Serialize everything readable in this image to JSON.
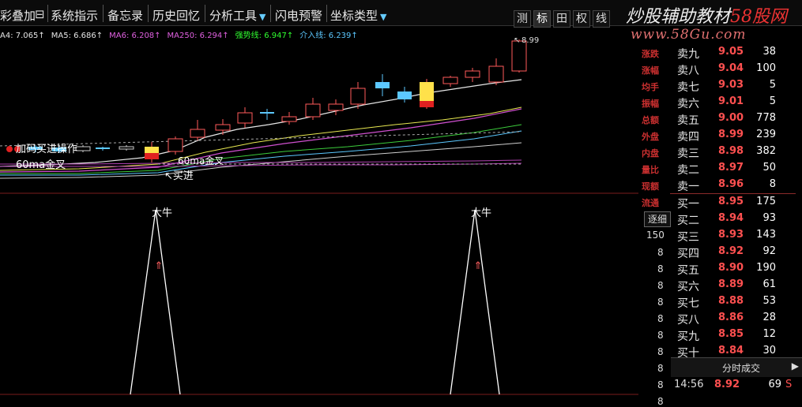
{
  "toolbar": {
    "items": [
      "彩叠加",
      "系统指示",
      "备忘录",
      "历史回忆",
      "分析工具",
      "闪电预警",
      "坐标类型"
    ],
    "right_buttons": [
      "测",
      "标",
      "田",
      "权",
      "线"
    ],
    "active_button": "标"
  },
  "watermark": {
    "text_prefix": "炒股辅助教材",
    "text_red": "58股网",
    "url": "www.58Gu.com"
  },
  "ma_indicators": [
    {
      "label": "A4: 7.065↑",
      "color": "#e6e6e6"
    },
    {
      "label": "MA5: 6.686↑",
      "color": "#e6e6e6"
    },
    {
      "label": "MA6: 6.208↑",
      "color": "#e060e0"
    },
    {
      "label": "MA250: 6.294↑",
      "color": "#e060e0"
    },
    {
      "label": "强势线: 6.947↑",
      "color": "#30ff30"
    },
    {
      "label": "介入线: 6.239↑",
      "color": "#5cc8ff"
    }
  ],
  "main_chart": {
    "high_label": "8.99",
    "annotations": {
      "add_position": "加码买进操作",
      "golden_cross": "60ma金叉",
      "follow_up": "60ma金叉",
      "buy": "买进"
    }
  },
  "indicator_chart": {
    "peak_label": "大牛",
    "peaks": [
      {
        "index": 0
      },
      {
        "index": 1
      }
    ]
  },
  "order_book": {
    "side_labels": [
      "涨跌",
      "涨幅",
      "均手",
      "振幅",
      "总额",
      "外盘",
      "内盘",
      "量比",
      "现额",
      "流通"
    ],
    "sells": [
      {
        "label": "卖九",
        "price": "9.05",
        "vol": "38"
      },
      {
        "label": "卖八",
        "price": "9.04",
        "vol": "100"
      },
      {
        "label": "卖七",
        "price": "9.03",
        "vol": "5"
      },
      {
        "label": "卖六",
        "price": "9.01",
        "vol": "5"
      },
      {
        "label": "卖五",
        "price": "9.00",
        "vol": "778"
      },
      {
        "label": "卖四",
        "price": "8.99",
        "vol": "239"
      },
      {
        "label": "卖三",
        "price": "8.98",
        "vol": "382"
      },
      {
        "label": "卖二",
        "price": "8.97",
        "vol": "50"
      },
      {
        "label": "卖一",
        "price": "8.96",
        "vol": "8"
      }
    ],
    "buys": [
      {
        "label": "买一",
        "price": "8.95",
        "vol": "175"
      },
      {
        "label": "买二",
        "price": "8.94",
        "vol": "93"
      },
      {
        "label": "买三",
        "price": "8.93",
        "vol": "143"
      },
      {
        "label": "买四",
        "price": "8.92",
        "vol": "92"
      },
      {
        "label": "买五",
        "price": "8.90",
        "vol": "190"
      },
      {
        "label": "买六",
        "price": "8.89",
        "vol": "61"
      },
      {
        "label": "买七",
        "price": "8.88",
        "vol": "53"
      },
      {
        "label": "买八",
        "price": "8.86",
        "vol": "28"
      },
      {
        "label": "买九",
        "price": "8.85",
        "vol": "12"
      },
      {
        "label": "买十",
        "price": "8.84",
        "vol": "30"
      }
    ],
    "detail_tab": "逐细",
    "detail_count": "150",
    "side_digits": [
      "8",
      "8",
      "8",
      "8",
      "8",
      "8",
      "8",
      "8",
      "8",
      "8"
    ]
  },
  "time_sales": {
    "tab_label": "分时成交",
    "rows": [
      {
        "time": "14:56",
        "price": "8.92",
        "vol": "69",
        "side": "S"
      }
    ]
  },
  "colors": {
    "candle_up": "#ff5a5a",
    "candle_cyan": "#6fe6ff",
    "yellow": "#ffe14a",
    "border_red": "#7a1b1b"
  }
}
